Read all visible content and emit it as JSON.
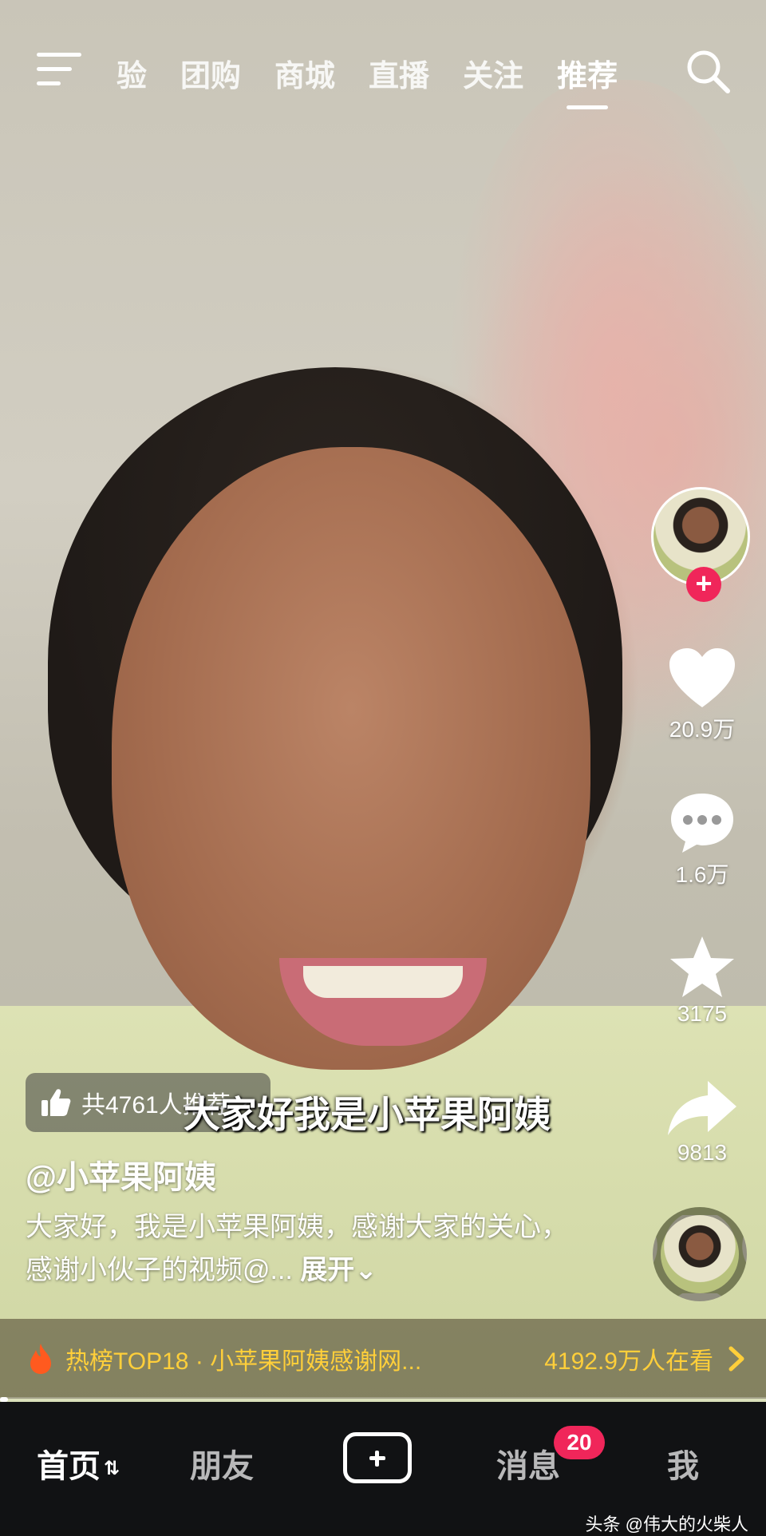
{
  "top_nav": {
    "tabs": [
      "验",
      "团购",
      "商城",
      "直播",
      "关注",
      "推荐"
    ],
    "active_tab": "推荐"
  },
  "actions": {
    "likes": "20.9万",
    "comments": "1.6万",
    "favorites": "3175",
    "shares": "9813"
  },
  "video": {
    "subtitle": "大家好我是小苹果阿姨",
    "recommend_text": "共4761人推荐",
    "author": "@小苹果阿姨",
    "description": "大家好，我是小苹果阿姨，感谢大家的关心，感谢小伙子的视频@...",
    "expand_label": "展开",
    "progress": 0.01
  },
  "hot_rank": {
    "title": "热榜TOP18 · 小苹果阿姨感谢网...",
    "viewers": "4192.9万人在看"
  },
  "bottom_nav": {
    "home": "首页",
    "friends": "朋友",
    "messages": "消息",
    "messages_badge": "20",
    "me": "我"
  },
  "watermark": "头条 @伟大的火柴人",
  "colors": {
    "accent_red": "#f0265a",
    "hot_yellow": "#ffcf3a",
    "nav_bg": "#111214"
  }
}
